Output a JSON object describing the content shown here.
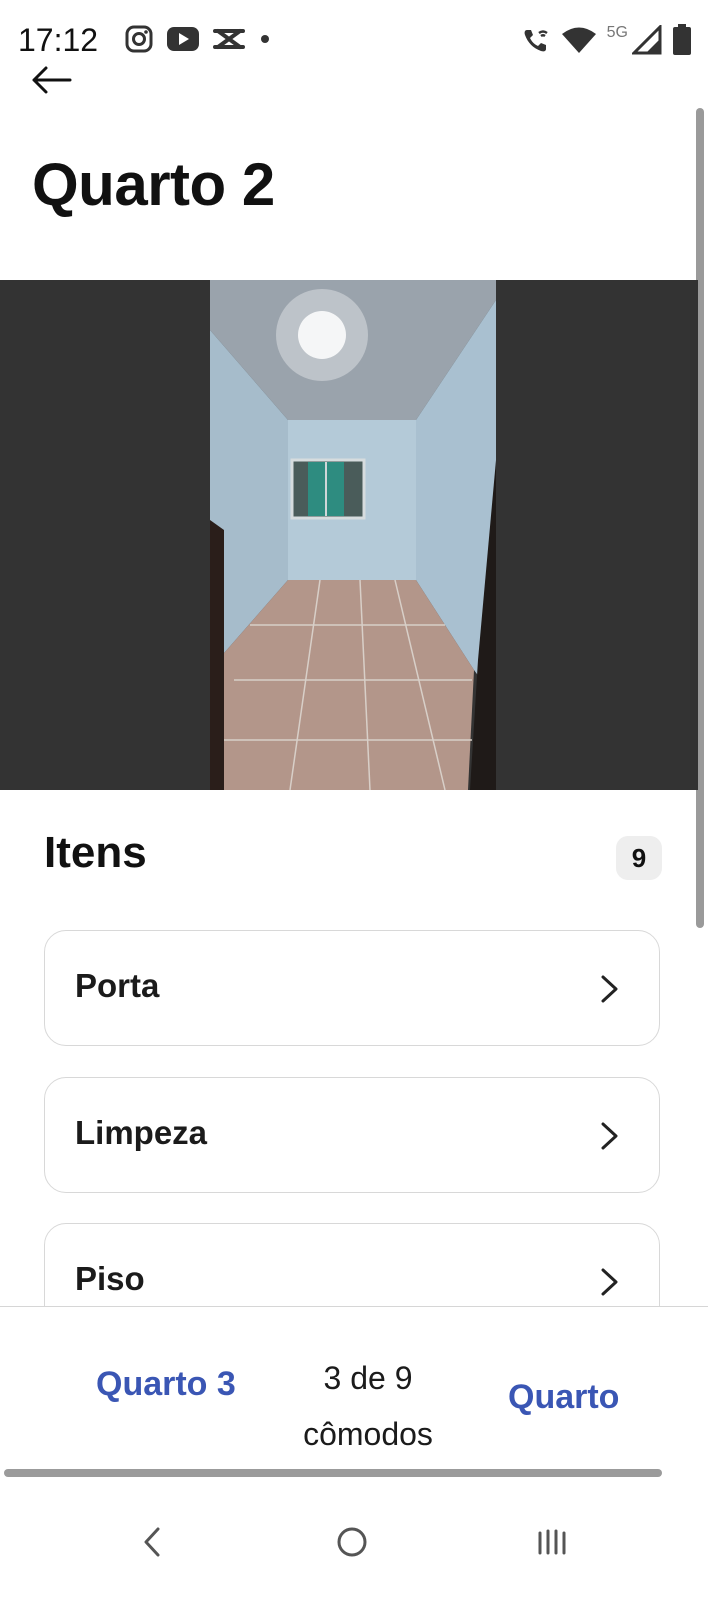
{
  "status_bar": {
    "time": "17:12",
    "network": "5G",
    "left_icons": [
      "instagram-icon",
      "youtube-icon",
      "capcut-icon",
      "notification-dot-icon"
    ],
    "right_icons": [
      "wifi-call-icon",
      "wifi-icon",
      "cell-signal-icon",
      "battery-icon"
    ]
  },
  "header": {
    "back_icon": "back-arrow-icon",
    "title": "Quarto 2"
  },
  "photo": {
    "background_color": "#333333"
  },
  "items_section": {
    "heading": "Itens",
    "count": "9",
    "items": [
      {
        "label": "Porta",
        "icon": "chevron-right-icon"
      },
      {
        "label": "Limpeza",
        "icon": "chevron-right-icon"
      },
      {
        "label": "Piso",
        "icon": "chevron-right-icon"
      }
    ]
  },
  "footer": {
    "prev_room": "Quarto 3",
    "counter_line1": "3 de 9",
    "counter_line2": "cômodos",
    "next_room": "Quarto",
    "accent_color": "#3a56b4"
  },
  "nav_bar": {
    "buttons": [
      "back-nav-icon",
      "home-nav-icon",
      "recents-nav-icon"
    ]
  }
}
